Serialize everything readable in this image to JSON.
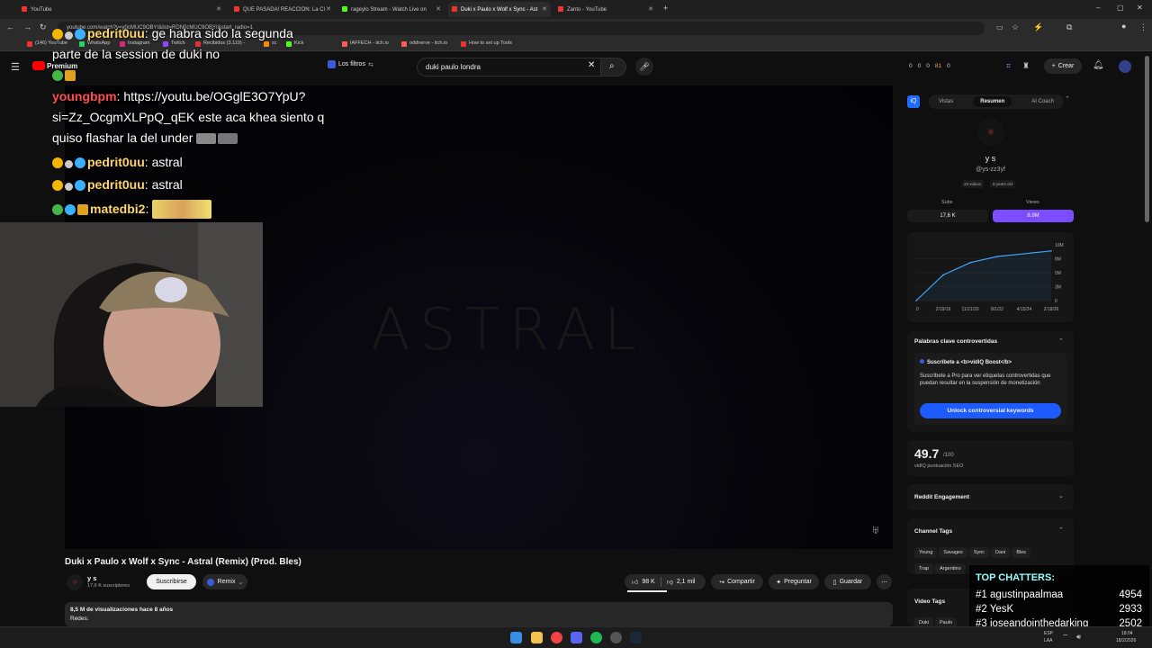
{
  "browser": {
    "tabs": [
      {
        "title": "YouTube"
      },
      {
        "title": "QUE PASADA! REACCION: La Cl"
      },
      {
        "title": "rageylo Stream - Watch Live on"
      },
      {
        "title": "Duki x Paulo x Wolf x Sync - Ast"
      },
      {
        "title": "Zanto - YouTube"
      }
    ],
    "url": "youtube.com/watch?v=y0cMUC9OBYI&list=RDN0cMUC9OBYI&start_radio=1",
    "bookmarks": [
      "(146) YouTube",
      "WhatsApp",
      "Instagram",
      "Twitch",
      "Recibidos (3.119) -",
      "sc",
      "Kick",
      "IAFFECH - itch.io",
      "oddnerve - itch.io",
      "How to set up Tools"
    ]
  },
  "youtube": {
    "premium_label": "Premium",
    "filters_label": "Los filtros",
    "search_value": "duki paulo londra",
    "create_label": "Crear",
    "header_stats": [
      "0",
      "0",
      "0",
      "81",
      "0"
    ],
    "video": {
      "logo_text": "ASTRAL",
      "title": "Duki x Paulo x Wolf x Sync - Astral (Remix) (Prod. Bles)",
      "channel": "y s",
      "subscribers": "17,6 K suscriptores",
      "subscribe_label": "Suscribirse",
      "remix_label": "Remix",
      "likes": "98 K",
      "dislikes": "2,1 mil",
      "share_label": "Compartir",
      "ask_label": "Preguntar",
      "save_label": "Guardar",
      "views_line": "8,5 M de visualizaciones  hace 8 años",
      "redes_label": "Redes:"
    }
  },
  "chat": [
    {
      "user": "pedrit0uu",
      "text": "ge habra sido la segunda"
    },
    {
      "user": "",
      "text": "parte de la session de duki no"
    },
    {
      "user": "youngbpm",
      "text": "https://youtu.be/OGglE3O7YpU?"
    },
    {
      "user": "",
      "text": "si=Zz_OcgmXLPpQ_qEK este aca khea siento q"
    },
    {
      "user": "",
      "text": "quiso flashar la del under"
    },
    {
      "user": "pedrit0uu",
      "text": "astral"
    },
    {
      "user": "pedrit0uu",
      "text": "astral"
    },
    {
      "user": "matedbi2",
      "text": ""
    }
  ],
  "vidiq": {
    "tabs": [
      "Vistas",
      "Resumen",
      "AI Coach"
    ],
    "channel_name": "y s",
    "channel_handle": "@ys-zz3yf",
    "videos_pill": "23 videos",
    "age_pill": "9 years old",
    "subs_label": "Subs",
    "subs_value": "17,6 K",
    "views_label": "Views",
    "views_value": "8.9M",
    "chart_y_ticks": [
      "10M",
      "8M",
      "5M",
      "3M",
      "0"
    ],
    "chart_x_ticks": [
      "0",
      "2/19/19",
      "11/21/20",
      "8/1/22",
      "4/15/24",
      "2/18/26"
    ],
    "keywords_title": "Palabras clave controvertidas",
    "boost_title": "Suscríbete a <b>vidIQ Boost</b>",
    "boost_text": "Suscríbete a Pro para ver etiquetas controvertidas que puedan resultar en la suspensión de monetización",
    "unlock_label": "Unlock controversial keywords",
    "seo_score": "49.7",
    "seo_max": "/100",
    "seo_label": "vidIQ puntuación SEO",
    "reddit_label": "Reddit Engagement",
    "channel_tags_label": "Channel Tags",
    "channel_tags": [
      "Young",
      "Savages",
      "Sync",
      "Dani",
      "Bles",
      "Trap",
      "Argentino"
    ],
    "video_tags_label": "Video Tags",
    "video_tags": [
      "Duki",
      "Paulo"
    ]
  },
  "chart_data": {
    "type": "line",
    "x": [
      "0",
      "2/19/19",
      "11/21/20",
      "8/1/22",
      "4/15/24",
      "2/18/26"
    ],
    "values": [
      0,
      4.6,
      6.8,
      7.9,
      8.4,
      8.9
    ],
    "ylim": [
      0,
      10
    ],
    "y_ticks": [
      "10M",
      "8M",
      "5M",
      "3M",
      "0"
    ],
    "color": "#3ea6ff"
  },
  "chatters": {
    "title": "TOP CHATTERS:",
    "rows": [
      {
        "rank": "#1",
        "name": "agustinpaalmaa",
        "count": "4954"
      },
      {
        "rank": "#2",
        "name": "YesK",
        "count": "2933"
      },
      {
        "rank": "#3",
        "name": "joseandointhedarking",
        "count": "2502"
      }
    ]
  },
  "taskbar": {
    "lang": "ESP",
    "lang2": "LAA",
    "time": "18:04",
    "date": "18/2/2026"
  }
}
